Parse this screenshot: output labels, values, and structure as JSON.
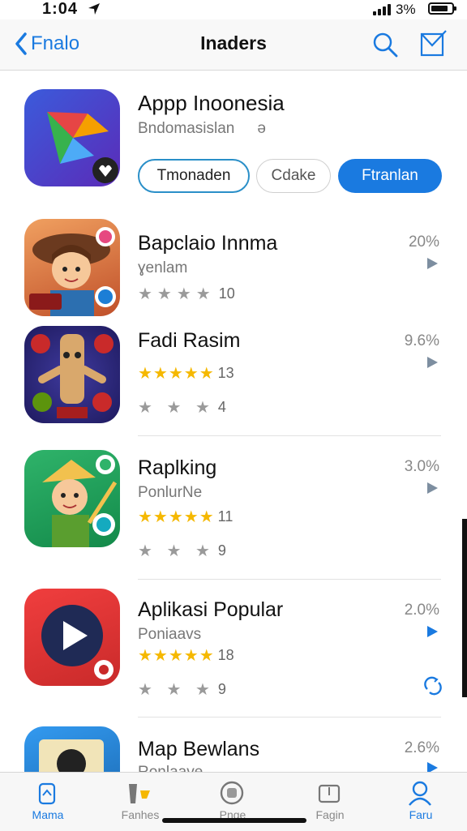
{
  "status": {
    "time": "1:04",
    "battery": "3%"
  },
  "nav": {
    "back_label": "Fnalo",
    "title": "Inaders"
  },
  "featured": {
    "name": "Appp Inoonesia",
    "subtitle": "Bndomasislan",
    "subtitle_extra": "ə",
    "buttons": [
      "Tmonaden",
      "Cdake",
      "Ftranlan"
    ]
  },
  "apps": [
    {
      "name": "Bapclaio Innma",
      "subtitle": "ɣenlam",
      "rating_gold": "",
      "rating_grey": "★★★★",
      "rating_count": "10",
      "extra_rating_grey": "",
      "extra_count": "",
      "percent": "20%"
    },
    {
      "name": "Fadi Rasim",
      "subtitle": "",
      "rating_gold": "★★★★★",
      "rating_grey": "",
      "rating_count": "13",
      "extra_rating_grey": "★ ★ ★",
      "extra_count": "4",
      "percent": "9.6%"
    },
    {
      "name": "Raplking",
      "subtitle": "PonlurNe",
      "rating_gold": "★★★★★",
      "rating_grey": "",
      "rating_count": "11",
      "extra_rating_grey": "★ ★ ★",
      "extra_count": "9",
      "percent": "3.0%"
    },
    {
      "name": "Aplikasi Popular",
      "subtitle": "Poniaavs",
      "rating_gold": "★★★★★",
      "rating_grey": "",
      "rating_count": "18",
      "extra_rating_grey": "★ ★ ★",
      "extra_count": "9",
      "percent": "2.0%"
    },
    {
      "name": "Map Bewlans",
      "subtitle": "Ronlaave",
      "rating_gold": "",
      "rating_grey": "",
      "rating_count": "",
      "extra_rating_grey": "",
      "extra_count": "",
      "percent": "2.6%"
    }
  ],
  "tabs": [
    {
      "label": "Mama",
      "icon": "home-icon"
    },
    {
      "label": "Fanhes",
      "icon": "games-icon"
    },
    {
      "label": "Pnge",
      "icon": "apps-icon"
    },
    {
      "label": "Fagin",
      "icon": "updates-icon"
    },
    {
      "label": "Faru",
      "icon": "person-icon"
    }
  ],
  "colors": {
    "accent": "#1a7ae0",
    "star": "#f5b800"
  }
}
